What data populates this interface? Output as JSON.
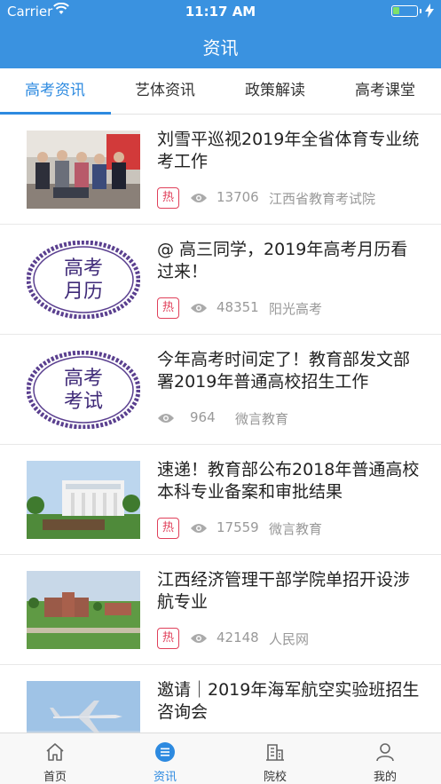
{
  "status_bar": {
    "carrier": "Carrier",
    "time": "11:17 AM"
  },
  "header": {
    "title": "资讯"
  },
  "tabs": [
    {
      "label": "高考资讯",
      "active": true
    },
    {
      "label": "艺体资讯",
      "active": false
    },
    {
      "label": "政策解读",
      "active": false
    },
    {
      "label": "高考课堂",
      "active": false
    }
  ],
  "articles": [
    {
      "title": "刘雪平巡视2019年全省体育专业统考工作",
      "hot": true,
      "hot_label": "热",
      "views": "13706",
      "source": "江西省教育考试院",
      "image": "photo-officials-icon"
    },
    {
      "title": "@ 高三同学，2019年高考月历看过来！",
      "hot": true,
      "hot_label": "热",
      "views": "48351",
      "source": "阳光高考",
      "image": "badge-gaokao-yueli",
      "badge_text": "高考月历"
    },
    {
      "title": "今年高考时间定了！教育部发文部署2019年普通高校招生工作",
      "hot": false,
      "hot_label": "",
      "views": "964",
      "source": "微言教育",
      "image": "badge-gaokao-kaoshi",
      "badge_text": "高考考试"
    },
    {
      "title": "速递！教育部公布2018年普通高校本科专业备案和审批结果",
      "hot": true,
      "hot_label": "热",
      "views": "17559",
      "source": "微言教育",
      "image": "photo-campus-gate-icon"
    },
    {
      "title": "江西经济管理干部学院单招开设涉航专业",
      "hot": true,
      "hot_label": "热",
      "views": "42148",
      "source": "人民网",
      "image": "photo-campus-aerial-icon"
    },
    {
      "title": "邀请｜2019年海军航空实验班招生咨询会",
      "hot": false,
      "hot_label": "",
      "views": "",
      "source": "",
      "image": "photo-jet-icon"
    }
  ],
  "tabbar": [
    {
      "label": "首页",
      "icon": "home-icon",
      "active": false
    },
    {
      "label": "资讯",
      "icon": "news-icon",
      "active": true
    },
    {
      "label": "院校",
      "icon": "school-icon",
      "active": false
    },
    {
      "label": "我的",
      "icon": "profile-icon",
      "active": false
    }
  ],
  "colors": {
    "brand": "#3a92e0",
    "accent": "#2d8ae0",
    "hot": "#e0405a",
    "badge_purple": "#5a3f8f"
  }
}
